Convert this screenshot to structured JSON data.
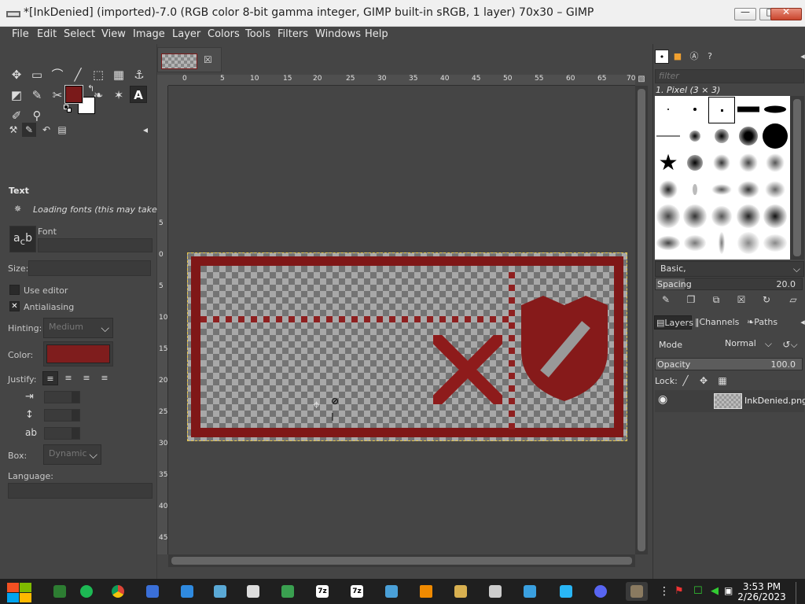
{
  "window": {
    "title": "*[InkDenied] (imported)-7.0 (RGB color 8-bit gamma integer, GIMP built-in sRGB, 1 layer) 70x30 – GIMP",
    "minimize": "—",
    "maximize": "□",
    "close": "✕"
  },
  "menubar": [
    "File",
    "Edit",
    "Select",
    "View",
    "Image",
    "Layer",
    "Colors",
    "Tools",
    "Filters",
    "Windows",
    "Help"
  ],
  "toolbox": {
    "tools": [
      "✥",
      "▭",
      "⌒",
      "╱",
      "⬚",
      "▦",
      "⚓",
      "◩",
      "✎",
      "✂",
      "⌆",
      "❧",
      "✶",
      "A",
      "✐",
      "⚲"
    ],
    "fg_color": "#7a1a1a",
    "bg_color": "#ffffff"
  },
  "tool_options": {
    "title": "Text",
    "loading": "Loading fonts (this may take a",
    "font_label": "Font",
    "size_label": "Size:",
    "size_value": "",
    "use_editor": "Use editor",
    "antialiasing": "Antialiasing",
    "antialias_check": "✕",
    "hinting_label": "Hinting:",
    "hinting_value": "Medium",
    "color_label": "Color:",
    "color_value": "#7f1d1d",
    "justify_label": "Justify:",
    "box_label": "Box:",
    "box_value": "Dynamic",
    "language_label": "Language:"
  },
  "canvas": {
    "ruler_top": [
      "0",
      "5",
      "10",
      "15",
      "20",
      "25",
      "30",
      "35",
      "40",
      "45",
      "50",
      "55",
      "60",
      "65",
      "70"
    ],
    "ruler_left": [
      "5",
      "0",
      "5",
      "10",
      "15",
      "20",
      "25",
      "30",
      "35",
      "40",
      "45"
    ]
  },
  "brushes": {
    "filter_placeholder": "filter",
    "current_brush": "1. Pixel (3 × 3)",
    "preset_label": "Basic,",
    "spacing_label": "Spacing",
    "spacing_value": "20.0",
    "spacing_fraction": 0.2
  },
  "layers": {
    "tabs": [
      "Layers",
      "Channels",
      "Paths"
    ],
    "mode_label": "Mode",
    "mode_value": "Normal",
    "opacity_label": "Opacity",
    "opacity_value": "100.0",
    "lock_label": "Lock:",
    "layer_name": "InkDenied.png"
  },
  "taskbar": {
    "time": "3:53 PM",
    "date": "2/26/2023",
    "apps": [
      "cmd",
      "spotify",
      "chrome",
      "app1",
      "app2",
      "app3",
      "app4",
      "app5",
      "7z",
      "7z",
      "app6",
      "vlc",
      "app7",
      "app8",
      "app9",
      "app10",
      "discord",
      "gimp"
    ]
  }
}
